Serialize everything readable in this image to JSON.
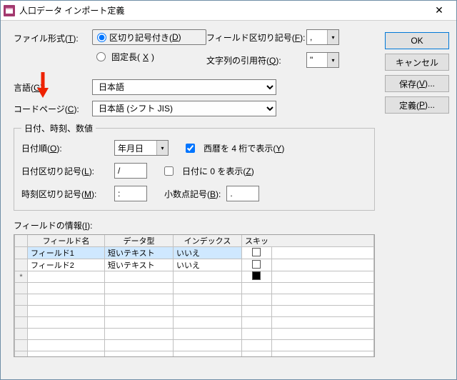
{
  "window": {
    "title": "人口データ インポート定義"
  },
  "buttons": {
    "ok": "OK",
    "cancel": "キャンセル",
    "save_prefix": "保存(",
    "save_accel": "V",
    "save_suffix": ")...",
    "defs_prefix": "定義(",
    "defs_accel": "P",
    "defs_suffix": ")..."
  },
  "format": {
    "label_prefix": "ファイル形式(",
    "label_accel": "T",
    "label_suffix": "):",
    "delim_prefix": "区切り記号付き(",
    "delim_accel": "D",
    "delim_suffix": ")",
    "fixed_prefix": "固定長(",
    "fixed_accel": "X",
    "fixed_suffix": ")"
  },
  "fieldsep": {
    "label_prefix": "フィールド区切り記号(",
    "label_accel": "F",
    "label_suffix": "):",
    "value": ","
  },
  "textqual": {
    "label_prefix": "文字列の引用符(",
    "label_accel": "Q",
    "label_suffix": "):",
    "value": "\""
  },
  "lang": {
    "label_prefix": "言語(",
    "label_accel": "G",
    "label_suffix": "):",
    "value": "日本語"
  },
  "codepage": {
    "label_prefix": "コードページ(",
    "label_accel": "C",
    "label_suffix": "):",
    "value": "日本語 (シフト JIS)"
  },
  "datetime": {
    "legend": "日付、時刻、数値",
    "order": {
      "label_prefix": "日付順(",
      "label_accel": "O",
      "label_suffix": "):",
      "value": "年月日"
    },
    "fourdigit": {
      "label_prefix": "西暦を 4 桁で表示(",
      "label_accel": "Y",
      "label_suffix": ")"
    },
    "datesep": {
      "label_prefix": "日付区切り記号(",
      "label_accel": "L",
      "label_suffix": "):",
      "value": "/"
    },
    "leadzero": {
      "label_prefix": "日付に 0 を表示(",
      "label_accel": "Z",
      "label_suffix": ")"
    },
    "timesep": {
      "label_prefix": "時刻区切り記号(",
      "label_accel": "M",
      "label_suffix": "):",
      "value": ":"
    },
    "decimal": {
      "label_prefix": "小数点記号(",
      "label_accel": "B",
      "label_suffix": "):",
      "value": "."
    }
  },
  "fieldinfo": {
    "label_prefix": "フィールドの情報(",
    "label_accel": "I",
    "label_suffix": "):",
    "headers": {
      "name": "フィールド名",
      "type": "データ型",
      "index": "インデックス",
      "skip": "スキッ"
    },
    "rows": [
      {
        "name": "フィールド1",
        "type": "短いテキスト",
        "index": "いいえ",
        "skip": false,
        "sel": true
      },
      {
        "name": "フィールド2",
        "type": "短いテキスト",
        "index": "いいえ",
        "skip": false,
        "sel": false
      }
    ],
    "newrow_marker": "*"
  }
}
